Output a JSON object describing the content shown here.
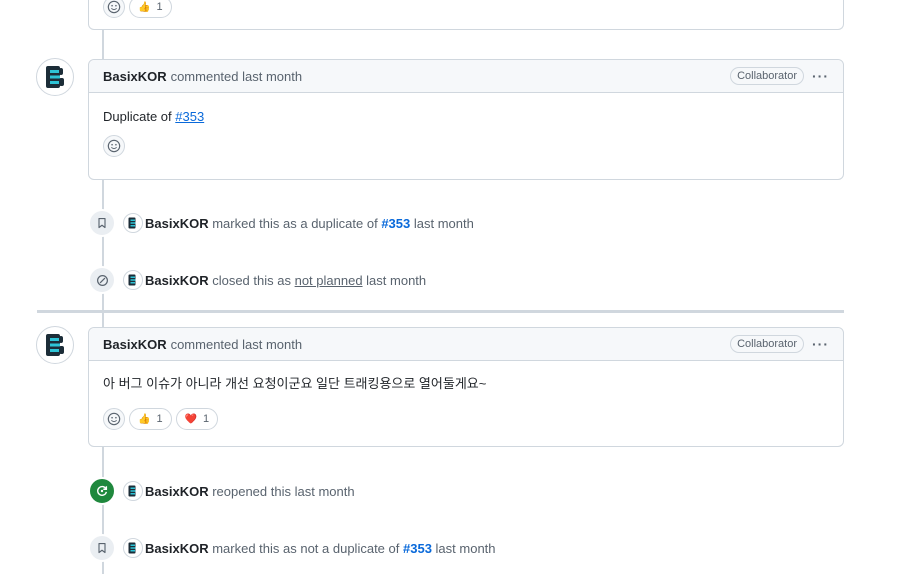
{
  "top_comment": {
    "reaction_thumbs": "👍",
    "reaction_count": "1"
  },
  "comment1": {
    "author": "BasixKOR",
    "meta": "commented last month",
    "badge": "Collaborator",
    "more": "···",
    "body_prefix": "Duplicate of ",
    "body_link": "#353"
  },
  "event_duplicate": {
    "author": "BasixKOR",
    "text": "marked this as a duplicate of",
    "link": "#353",
    "time": "last month"
  },
  "event_closed": {
    "author": "BasixKOR",
    "text": "closed this as",
    "reason": "not planned",
    "time": "last month"
  },
  "comment2": {
    "author": "BasixKOR",
    "meta": "commented last month",
    "badge": "Collaborator",
    "more": "···",
    "body": "아 버그 이슈가 아니라 개선 요청이군요 일단 트래킹용으로 열어둘게요~",
    "reactions": [
      {
        "emoji": "👍",
        "count": "1"
      },
      {
        "emoji": "❤️",
        "count": "1"
      }
    ]
  },
  "event_reopened": {
    "author": "BasixKOR",
    "text": "reopened this last month"
  },
  "event_not_duplicate": {
    "author": "BasixKOR",
    "text": "marked this as not a duplicate of",
    "link": "#353",
    "time": "last month"
  },
  "colors": {
    "link": "#0969da",
    "reopen_green": "#1f883d",
    "border": "#d0d7de"
  }
}
